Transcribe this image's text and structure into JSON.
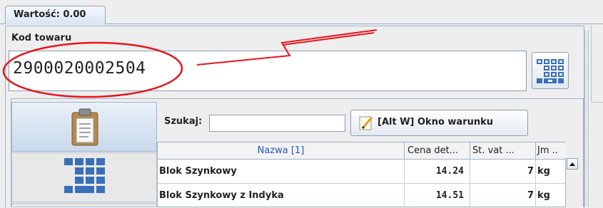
{
  "tab": {
    "label": "Wartość: 0.00"
  },
  "code": {
    "label": "Kod towaru",
    "value": "2900020002504"
  },
  "search": {
    "label": "Szukaj:",
    "value": ""
  },
  "condition_button": {
    "label": "[Alt W] Okno warunku"
  },
  "table": {
    "headers": [
      "Nazwa [1]",
      "Cena det...",
      "St. vat ...",
      "Jm .."
    ],
    "rows": [
      {
        "name": "Blok Szynkowy",
        "price": "14.24",
        "vat": "7",
        "unit": "kg"
      },
      {
        "name": "Blok Szynkowy z Indyka",
        "price": "14.51",
        "vat": "7",
        "unit": "kg"
      }
    ]
  },
  "icons": {
    "calculator": "calculator-keypad-icon",
    "clipboard": "clipboard-icon",
    "keypad": "numeric-keypad-icon",
    "edit": "pencil-note-icon",
    "scroll_up": "scroll-up-arrow-icon"
  },
  "colors": {
    "accent": "#2456c4",
    "annotation": "#e8141c",
    "border": "#8fa9c9"
  }
}
